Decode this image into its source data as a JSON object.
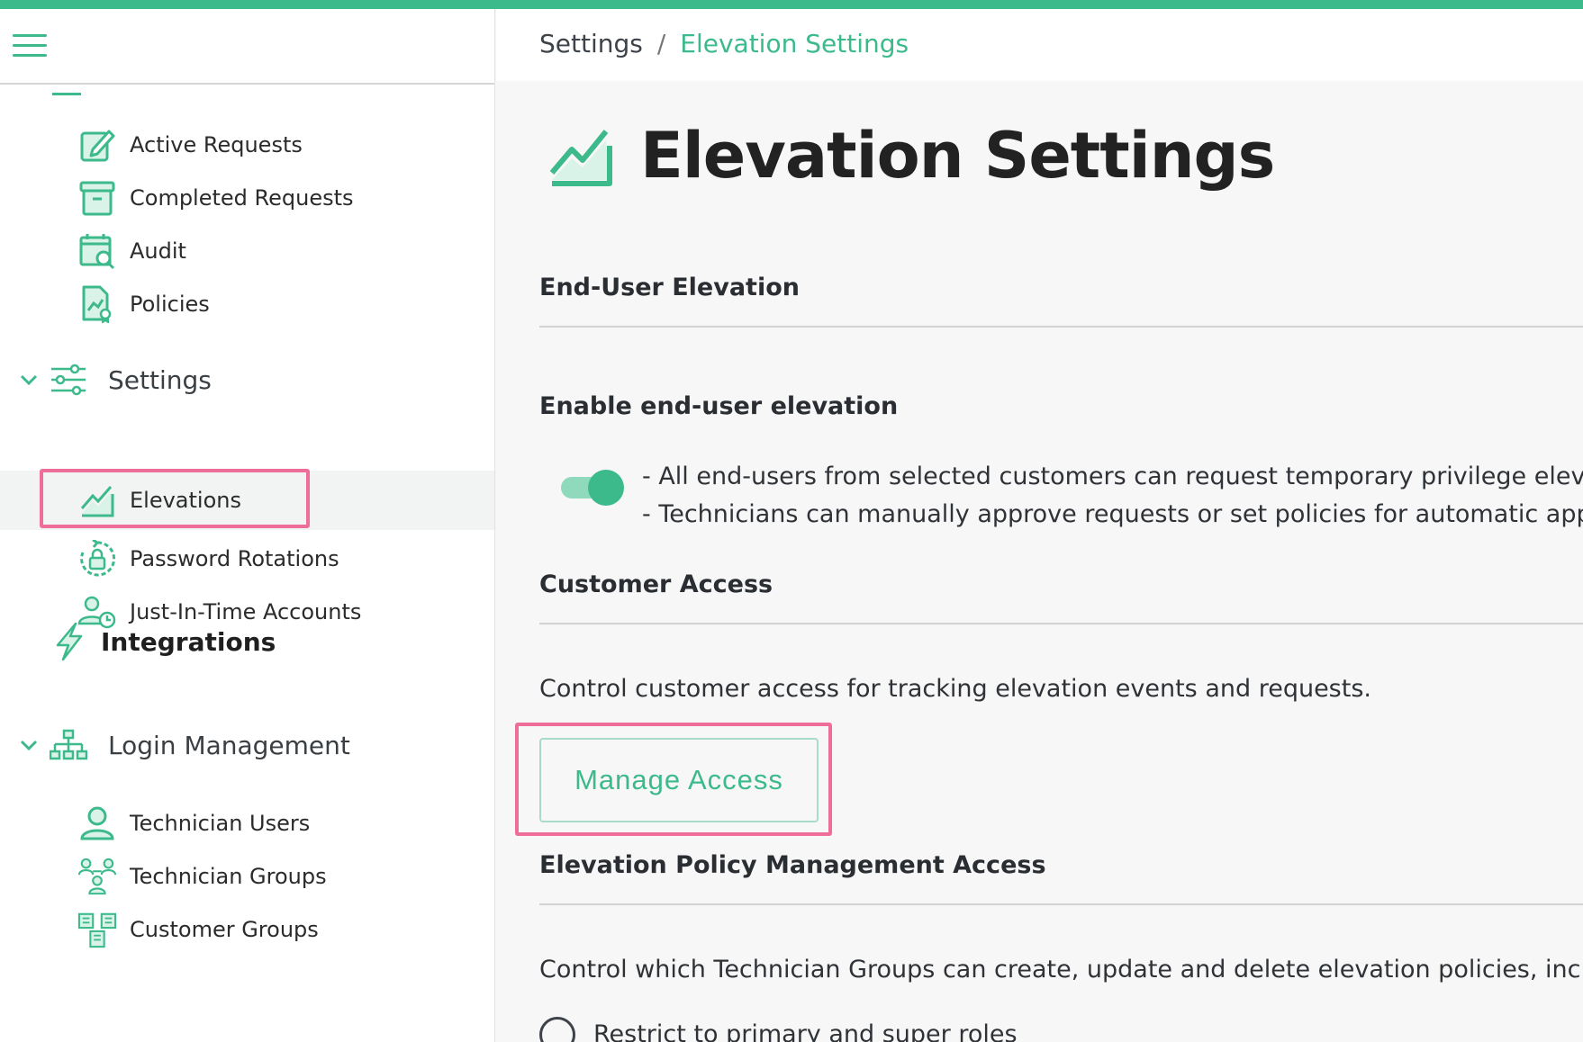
{
  "colors": {
    "accent": "#3dba8c",
    "highlight": "#ee6d99"
  },
  "sidebar": {
    "items_top": [
      {
        "label": "Active Requests",
        "icon": "edit-note-icon"
      },
      {
        "label": "Completed Requests",
        "icon": "archive-box-icon"
      },
      {
        "label": "Audit",
        "icon": "calendar-search-icon"
      },
      {
        "label": "Policies",
        "icon": "policy-document-icon"
      }
    ],
    "settings_section": {
      "label": "Settings",
      "icon": "sliders-icon"
    },
    "settings_items": [
      {
        "label": "Elevations",
        "icon": "elevation-chart-icon"
      },
      {
        "label": "Password Rotations",
        "icon": "password-rotation-icon"
      },
      {
        "label": "Just-In-Time Accounts",
        "icon": "user-clock-icon"
      }
    ],
    "integrations": {
      "label": "Integrations",
      "icon": "lightning-icon"
    },
    "login_section": {
      "label": "Login Management",
      "icon": "org-chart-icon"
    },
    "login_items": [
      {
        "label": "Technician Users",
        "icon": "user-icon"
      },
      {
        "label": "Technician Groups",
        "icon": "user-group-icon"
      },
      {
        "label": "Customer Groups",
        "icon": "buildings-icon"
      }
    ]
  },
  "breadcrumb": {
    "root": "Settings",
    "separator": "/",
    "current": "Elevation Settings"
  },
  "page": {
    "title": "Elevation Settings",
    "end_user_section": {
      "title": "End-User Elevation",
      "toggle_label": "Enable end-user elevation",
      "toggle_on": true,
      "lines": [
        "- All end-users from selected customers can request temporary privilege elevat",
        "- Technicians can manually approve requests or set policies for automatic appr"
      ]
    },
    "customer_access": {
      "title": "Customer Access",
      "description": "Control customer access for tracking elevation events and requests.",
      "button_label": "Manage Access"
    },
    "policy_management": {
      "title": "Elevation Policy Management Access",
      "description": "Control which Technician Groups can create, update and delete elevation policies, inclu",
      "radio_label": "Restrict to primary and super roles"
    }
  }
}
